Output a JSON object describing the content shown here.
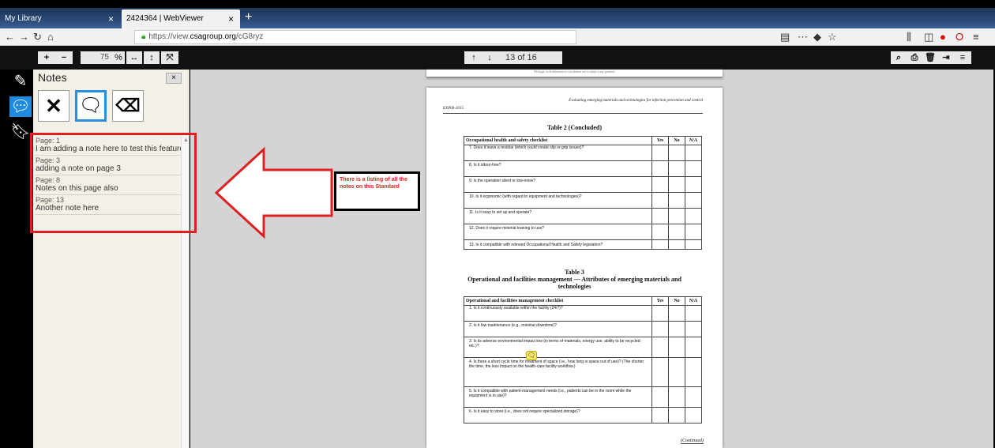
{
  "browser": {
    "tabs": [
      {
        "label": "My Library",
        "close": "×"
      },
      {
        "label": "2424364 | WebViewer",
        "close": "×"
      }
    ],
    "new_tab": "+",
    "url_scheme": "https://view.",
    "url_host": "csagroup.org",
    "url_path": "/cG8ryz"
  },
  "viewer_toolbar": {
    "zoom_in": "+",
    "zoom_out": "−",
    "zoom_value": "75",
    "zoom_unit": "%",
    "fit_width": "↔",
    "fit_height": "↕",
    "fullscreen": "⤧",
    "prev": "↑",
    "next": "↓",
    "current_page": "13",
    "page_of": "of 16"
  },
  "notes_panel": {
    "title": "Notes",
    "close": "×",
    "notes": [
      {
        "page": "Page: 1",
        "text": "I am adding a note here to test this feature"
      },
      {
        "page": "Page: 3",
        "text": "adding a note on page 3"
      },
      {
        "page": "Page: 8",
        "text": "Notes on this page also"
      },
      {
        "page": "Page: 13",
        "text": "Another note here"
      }
    ]
  },
  "callout": {
    "text": "There is a listing of all the notes on this Standard"
  },
  "document": {
    "prev_page_footer": "Package, is distribution or circulation are is subject any granted.",
    "doc_id": "EXP06-2015",
    "running_head": "Evaluating emerging materials and technologies for infection prevention and control",
    "table2_title": "Table 2 (Concluded)",
    "table2_header": "Occupational health and safety checklist",
    "col_yes": "Yes",
    "col_no": "No",
    "col_na": "N/A",
    "table2_rows": [
      "7.  Does it leave a residue (which could create slip or grip issues)?",
      "8.  Is it odour-free?",
      "9.  Is the operation silent or low-noise?",
      "10.  Is it ergonomic (with regard to equipment and technologies)?",
      "11.  Is it easy to set up and operate?",
      "12.  Does it require minimal training to use?",
      "13.  Is it compatible with relevant Occupational Health and Safety legislation?"
    ],
    "table3_title": "Table 3",
    "table3_subtitle": "Operational and facilities management — Attributes of emerging materials and technologies",
    "table3_header": "Operational and facilities management checklist",
    "table3_rows": [
      "1.  Is it continuously available within the facility (24/7)?",
      "2.  Is it low maintenance (e.g., minimal downtime)?",
      "3.  Is its adverse environmental impact low (in terms of materials, energy use, ability to be recycled, etc.)?",
      "4.  Is there a short cycle time for treatment of space (i.e., how long is space out of use)? (The shorter the time, the less impact on the health-care facility workflow.)",
      "5.  Is it compatible with patient-management needs (i.e., patients can be in the room while the equipment is in use)?",
      "6.  Is it easy to store (i.e., does not require specialized storage)?"
    ],
    "continued": "(Continued)"
  },
  "colors": {
    "accent_blue": "#2a8de0",
    "highlight_red": "#e02020",
    "panel_bg": "#f3f1e7",
    "sticky_yellow": "#f6e66a"
  }
}
